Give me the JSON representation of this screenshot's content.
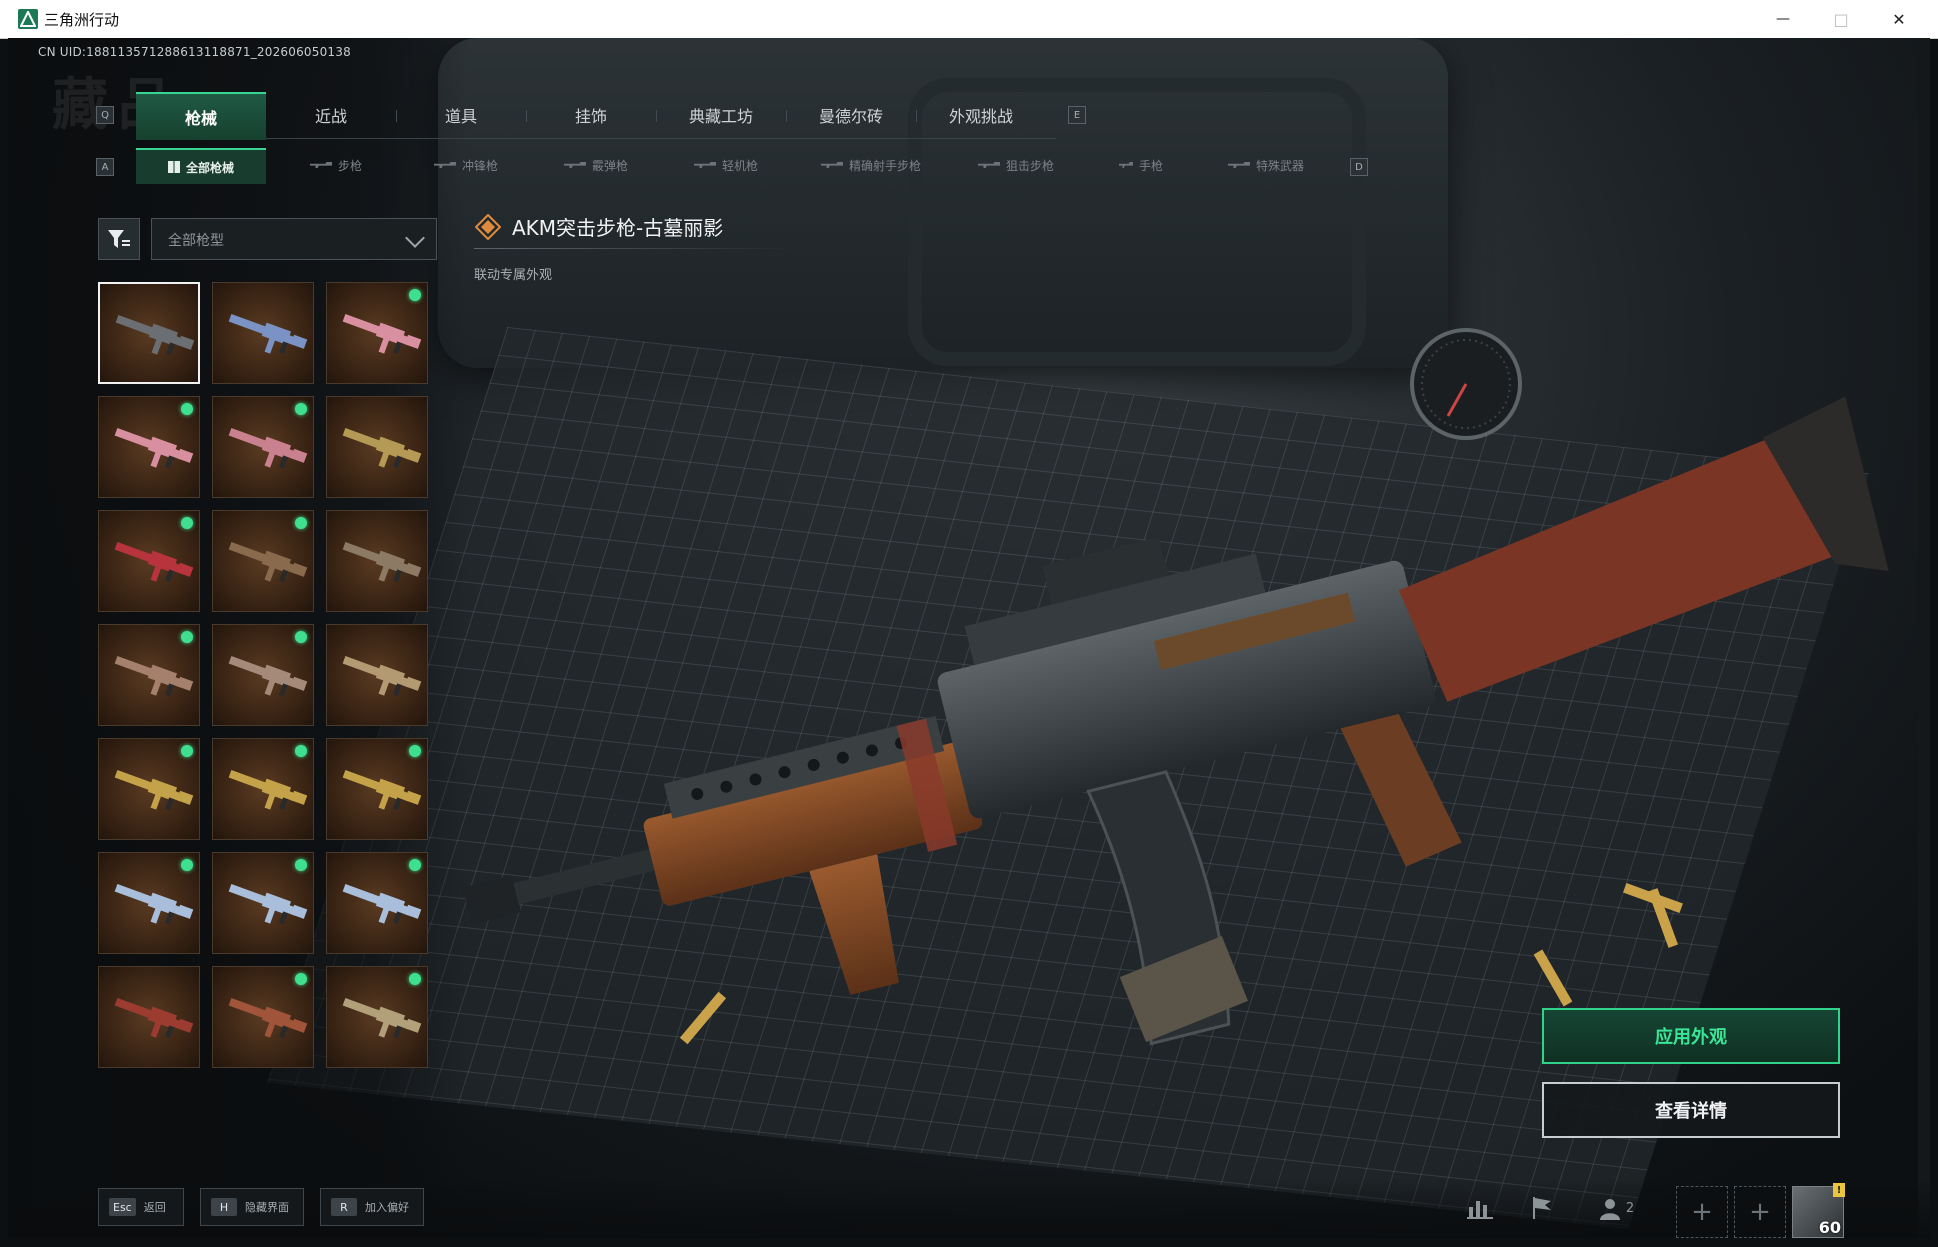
{
  "window": {
    "title": "三角洲行动",
    "controls": {
      "minimize": "—",
      "maximize": "□",
      "close": "✕"
    }
  },
  "uid": "CN UID:18811357128861311887​1_202606050138",
  "tabs": [
    {
      "label": "枪械",
      "active": true
    },
    {
      "label": "近战"
    },
    {
      "label": "道具"
    },
    {
      "label": "挂饰"
    },
    {
      "label": "典藏工坊"
    },
    {
      "label": "曼德尔砖"
    },
    {
      "label": "外观挑战"
    }
  ],
  "tab_keys": {
    "left": "Q",
    "right": "E"
  },
  "subtabs": [
    {
      "label": "全部枪械",
      "active": true
    },
    {
      "label": "步枪"
    },
    {
      "label": "冲锋枪"
    },
    {
      "label": "霰弹枪"
    },
    {
      "label": "轻机枪"
    },
    {
      "label": "精确射手步枪"
    },
    {
      "label": "狙击步枪"
    },
    {
      "label": "手枪"
    },
    {
      "label": "特殊武器"
    }
  ],
  "subtab_keys": {
    "left": "A",
    "right": "D"
  },
  "filter": {
    "value": "全部枪型"
  },
  "skins": [
    {
      "tone": "#6b6f73",
      "dot": false,
      "selected": true
    },
    {
      "tone": "#7a93c4",
      "dot": false
    },
    {
      "tone": "#d88fa0",
      "dot": true
    },
    {
      "tone": "#d88fa0",
      "dot": true
    },
    {
      "tone": "#c9808f",
      "dot": true
    },
    {
      "tone": "#b59a55",
      "dot": false
    },
    {
      "tone": "#b8343d",
      "dot": true
    },
    {
      "tone": "#8a6a4d",
      "dot": true
    },
    {
      "tone": "#8c7a64",
      "dot": false
    },
    {
      "tone": "#a5806d",
      "dot": true
    },
    {
      "tone": "#a58a7a",
      "dot": true
    },
    {
      "tone": "#b39a72",
      "dot": false
    },
    {
      "tone": "#c4a24a",
      "dot": true
    },
    {
      "tone": "#c4a24a",
      "dot": true
    },
    {
      "tone": "#c4a24a",
      "dot": true
    },
    {
      "tone": "#a9bedb",
      "dot": true
    },
    {
      "tone": "#a9bedb",
      "dot": true
    },
    {
      "tone": "#a9bedb",
      "dot": true
    },
    {
      "tone": "#9c3b30",
      "dot": false
    },
    {
      "tone": "#a0553a",
      "dot": true
    },
    {
      "tone": "#b2a07a",
      "dot": true
    }
  ],
  "weapon": {
    "name": "AKM突击步枪-古墓丽影",
    "subtitle": "联动专属外观"
  },
  "actions": {
    "apply": "应用外观",
    "details": "查看详情"
  },
  "hints": [
    {
      "key": "Esc",
      "label": "返回"
    },
    {
      "key": "H",
      "label": "隐藏界面"
    },
    {
      "key": "R",
      "label": "加入偏好"
    }
  ],
  "bottom_right": {
    "friends_count": "2",
    "level": "60",
    "alert": "!"
  },
  "colors": {
    "accent": "#37d58f",
    "apply_text": "#3ae596",
    "skin_dot": "#3ee08f"
  }
}
